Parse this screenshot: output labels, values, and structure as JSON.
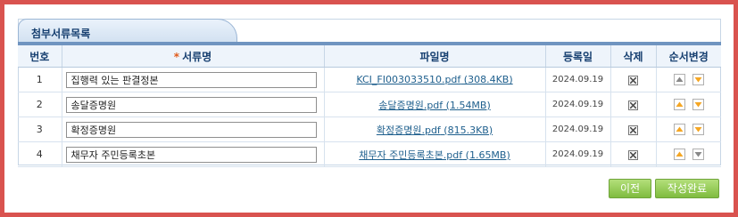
{
  "panel": {
    "title": "첨부서류목록"
  },
  "table": {
    "headers": {
      "no": "번호",
      "required_mark": "*",
      "doc_name": "서류명",
      "file_name": "파일명",
      "reg_date": "등록일",
      "delete": "삭제",
      "order": "순서변경"
    },
    "rows": [
      {
        "no": "1",
        "doc_name": "집행력 있는 판결정본",
        "file_link": "KCI_FI003033510.pdf",
        "file_size": " (308.4KB)",
        "date": "2024.09.19"
      },
      {
        "no": "2",
        "doc_name": "송달증명원",
        "file_link": "송달증명원.pdf",
        "file_size": " (1.54MB)",
        "date": "2024.09.19"
      },
      {
        "no": "3",
        "doc_name": "확정증명원",
        "file_link": "확정증명원.pdf",
        "file_size": " (815.3KB)",
        "date": "2024.09.19"
      },
      {
        "no": "4",
        "doc_name": "채무자 주민등록초본",
        "file_link": "채무자 주민등록초본.pdf",
        "file_size": " (1.65MB)",
        "date": "2024.09.19"
      }
    ]
  },
  "buttons": {
    "prev": "이전",
    "complete": "작성완료"
  },
  "colors": {
    "header_text": "#163f70",
    "link": "#1e5f8d",
    "button_green": "#8cc34a",
    "up_arrow_active": "#f5a623",
    "arrow_inactive": "#888888"
  },
  "icons": {
    "delete": "close-box-icon",
    "up": "arrow-up-icon",
    "down": "arrow-down-icon"
  }
}
